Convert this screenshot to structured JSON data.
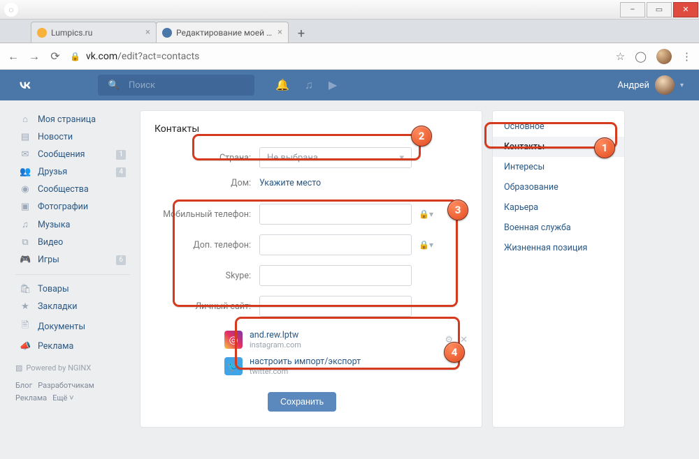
{
  "browser": {
    "tabs": [
      {
        "label": "Lumpics.ru",
        "favicon": "#f7b13c"
      },
      {
        "label": "Редактирование моей страниц",
        "favicon": "#4a76a8"
      }
    ],
    "newtab": "+",
    "url_prefix": "vk.com",
    "url_path": "/edit?act=contacts"
  },
  "vk": {
    "search_placeholder": "Поиск",
    "username": "Андрей",
    "leftnav": [
      {
        "icon": "⌂",
        "label": "Моя страница"
      },
      {
        "icon": "▤",
        "label": "Новости"
      },
      {
        "icon": "✉",
        "label": "Сообщения",
        "badge": "1"
      },
      {
        "icon": "👥",
        "label": "Друзья",
        "badge": "4"
      },
      {
        "icon": "◉",
        "label": "Сообщества"
      },
      {
        "icon": "▣",
        "label": "Фотографии"
      },
      {
        "icon": "♫",
        "label": "Музыка"
      },
      {
        "icon": "⧉",
        "label": "Видео"
      },
      {
        "icon": "🎮",
        "label": "Игры",
        "badge": "6"
      }
    ],
    "leftnav2": [
      {
        "icon": "🛍",
        "label": "Товары"
      },
      {
        "icon": "★",
        "label": "Закладки"
      },
      {
        "icon": "🖹",
        "label": "Документы"
      },
      {
        "icon": "📣",
        "label": "Реклама"
      }
    ],
    "powered": "Powered by NGINX",
    "footer": [
      "Блог",
      "Разработчикам",
      "Реклама",
      "Ещё ˅"
    ],
    "page_title": "Контакты",
    "fields": {
      "country_label": "Страна:",
      "country_value": "Не выбрана",
      "home_label": "Дом:",
      "home_value": "Укажите место",
      "mobile_label": "Мобильный телефон:",
      "alt_label": "Доп. телефон:",
      "skype_label": "Skype:",
      "site_label": "Личный сайт:"
    },
    "social": [
      {
        "net": "ig",
        "line1": "and.rew.lptw",
        "line2": "instagram.com",
        "gear": true
      },
      {
        "net": "tw",
        "line1": "настроить импорт/экспорт",
        "line2": "twitter.com",
        "gear": false
      }
    ],
    "save_label": "Сохранить",
    "rightnav": [
      "Основное",
      "Контакты",
      "Интересы",
      "Образование",
      "Карьера",
      "Военная служба",
      "Жизненная позиция"
    ],
    "rightnav_active": 1
  },
  "annotations": {
    "b1": "1",
    "b2": "2",
    "b3": "3",
    "b4": "4"
  }
}
